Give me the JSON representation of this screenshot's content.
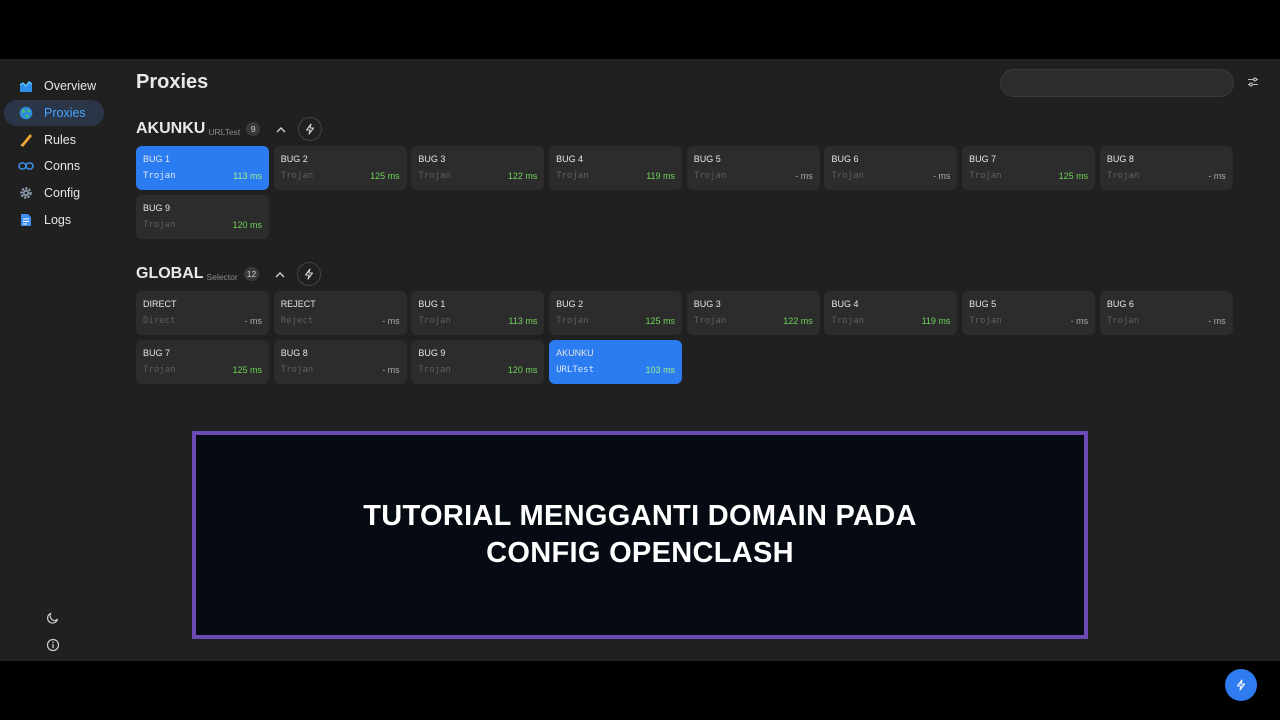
{
  "sidebar": {
    "items": [
      {
        "label": "Overview",
        "icon": "chart-icon"
      },
      {
        "label": "Proxies",
        "icon": "globe-icon"
      },
      {
        "label": "Rules",
        "icon": "ruler-icon"
      },
      {
        "label": "Conns",
        "icon": "link-icon"
      },
      {
        "label": "Config",
        "icon": "gear-icon"
      },
      {
        "label": "Logs",
        "icon": "document-icon"
      }
    ],
    "active": "Proxies"
  },
  "header": {
    "title": "Proxies",
    "search_placeholder": ""
  },
  "groups": [
    {
      "name": "AKUNKU",
      "type": "URLTest",
      "count": "9",
      "proxies": [
        {
          "name": "BUG 1",
          "type": "Trojan",
          "delay": "113 ms",
          "ok": true,
          "active": true
        },
        {
          "name": "BUG 2",
          "type": "Trojan",
          "delay": "125 ms",
          "ok": true
        },
        {
          "name": "BUG 3",
          "type": "Trojan",
          "delay": "122 ms",
          "ok": true
        },
        {
          "name": "BUG 4",
          "type": "Trojan",
          "delay": "119 ms",
          "ok": true
        },
        {
          "name": "BUG 5",
          "type": "Trojan",
          "delay": "- ms",
          "ok": false
        },
        {
          "name": "BUG 6",
          "type": "Trojan",
          "delay": "- ms",
          "ok": false
        },
        {
          "name": "BUG 7",
          "type": "Trojan",
          "delay": "125 ms",
          "ok": true
        },
        {
          "name": "BUG 8",
          "type": "Trojan",
          "delay": "- ms",
          "ok": false
        },
        {
          "name": "BUG 9",
          "type": "Trojan",
          "delay": "120 ms",
          "ok": true
        }
      ]
    },
    {
      "name": "GLOBAL",
      "type": "Selector",
      "count": "12",
      "proxies": [
        {
          "name": "DIRECT",
          "type": "Direct",
          "delay": "- ms",
          "ok": false
        },
        {
          "name": "REJECT",
          "type": "Reject",
          "delay": "- ms",
          "ok": false
        },
        {
          "name": "BUG 1",
          "type": "Trojan",
          "delay": "113 ms",
          "ok": true
        },
        {
          "name": "BUG 2",
          "type": "Trojan",
          "delay": "125 ms",
          "ok": true
        },
        {
          "name": "BUG 3",
          "type": "Trojan",
          "delay": "122 ms",
          "ok": true
        },
        {
          "name": "BUG 4",
          "type": "Trojan",
          "delay": "119 ms",
          "ok": true
        },
        {
          "name": "BUG 5",
          "type": "Trojan",
          "delay": "- ms",
          "ok": false
        },
        {
          "name": "BUG 6",
          "type": "Trojan",
          "delay": "- ms",
          "ok": false
        },
        {
          "name": "BUG 7",
          "type": "Trojan",
          "delay": "125 ms",
          "ok": true
        },
        {
          "name": "BUG 8",
          "type": "Trojan",
          "delay": "- ms",
          "ok": false
        },
        {
          "name": "BUG 9",
          "type": "Trojan",
          "delay": "120 ms",
          "ok": true
        },
        {
          "name": "AKUNKU",
          "type": "URLTest",
          "delay": "103 ms",
          "ok": true,
          "active": true
        }
      ]
    }
  ],
  "banner": {
    "line1": "TUTORIAL MENGGANTI DOMAIN PADA",
    "line2": "CONFIG OPENCLASH"
  },
  "colors": {
    "accent": "#2b7cf0",
    "delay_ok": "#6fd35a",
    "banner_border": "#6a4bb5",
    "background": "#202020"
  }
}
